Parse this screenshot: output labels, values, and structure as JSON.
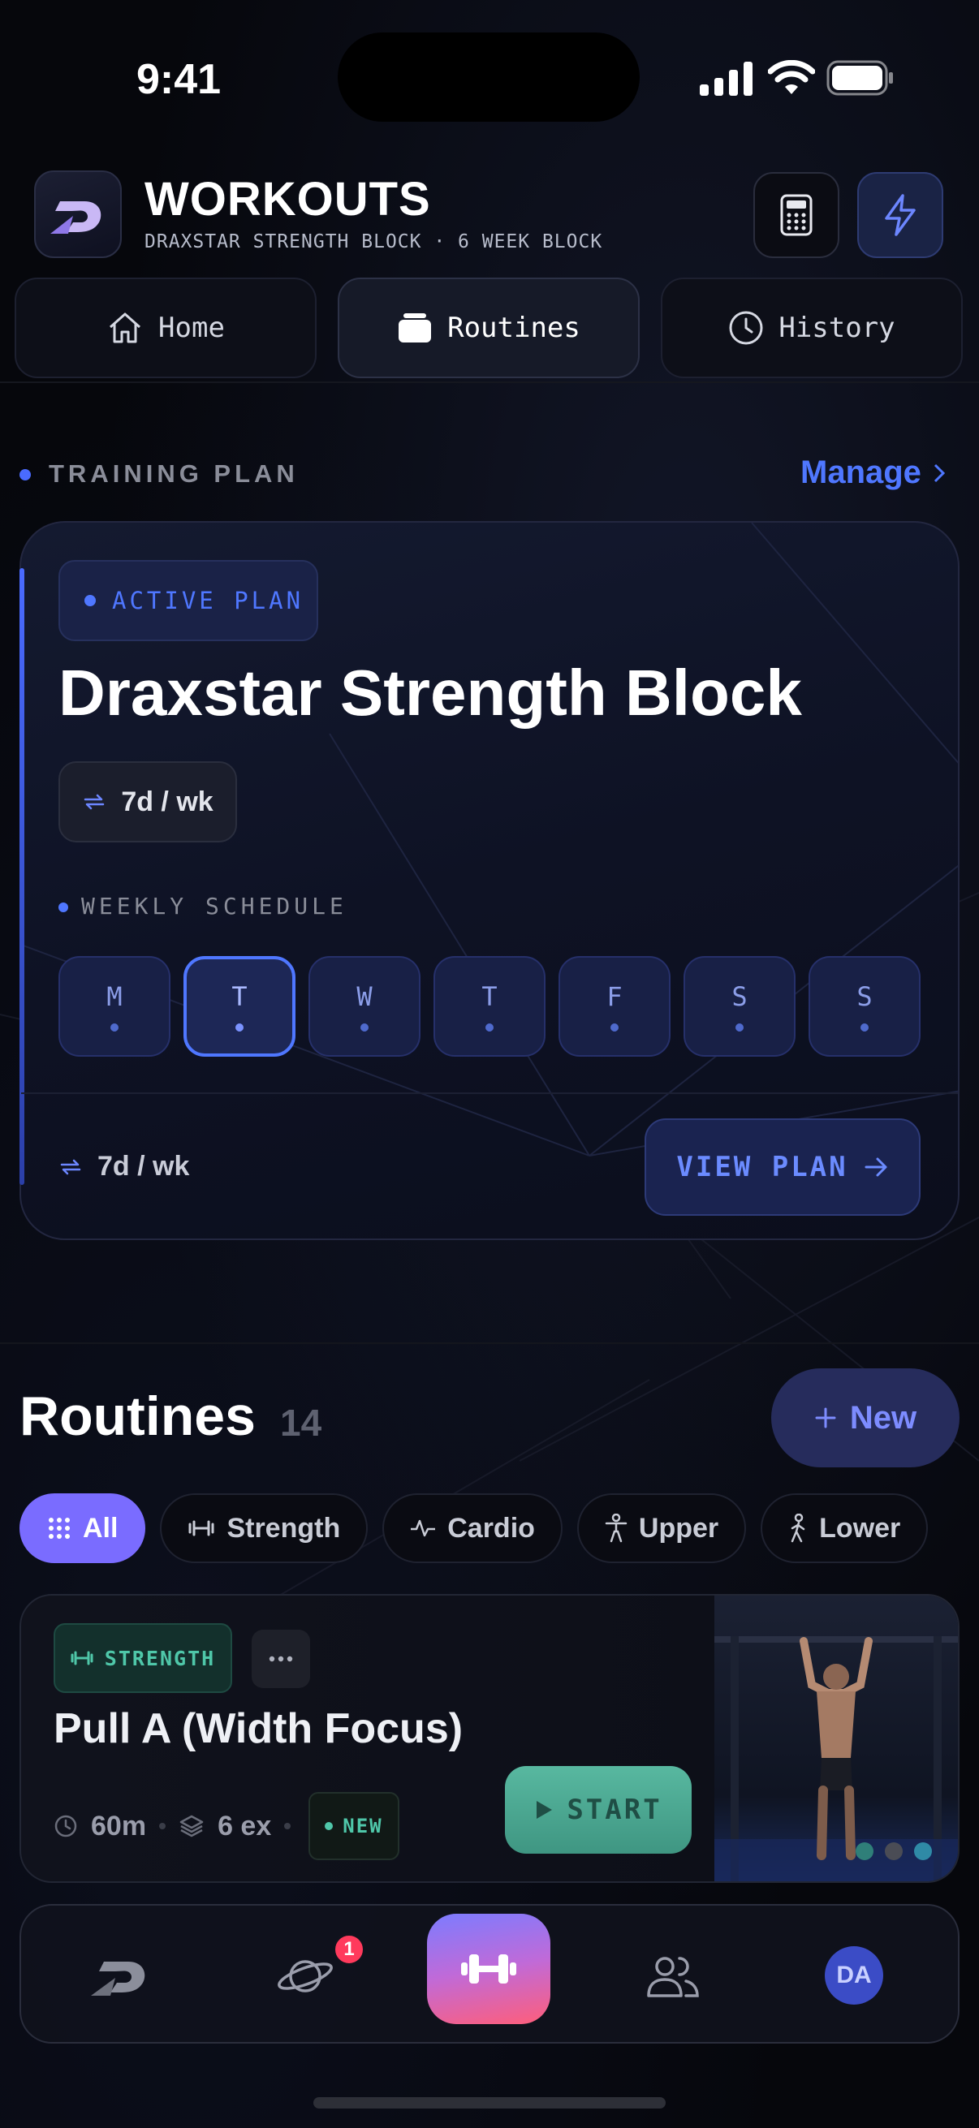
{
  "status_bar": {
    "time": "9:41"
  },
  "header": {
    "title": "WORKOUTS",
    "subtitle": "DRAXSTAR STRENGTH BLOCK · 6 WEEK BLOCK",
    "icons": [
      "app-logo",
      "calculator-icon",
      "bolt-icon"
    ]
  },
  "tabs": [
    {
      "label": "Home",
      "icon": "home-icon"
    },
    {
      "label": "Routines",
      "icon": "folder-icon",
      "active": true
    },
    {
      "label": "History",
      "icon": "clock-icon"
    }
  ],
  "training_plan": {
    "section_label": "TRAINING PLAN",
    "manage_label": "Manage",
    "status_label": "ACTIVE PLAN",
    "name": "Draxstar Strength Block",
    "frequency": "7d / wk",
    "schedule_label": "WEEKLY SCHEDULE",
    "days": [
      "M",
      "T",
      "W",
      "T",
      "F",
      "S",
      "S"
    ],
    "current_day_index": 1,
    "footer_frequency": "7d / wk",
    "view_plan_label": "VIEW PLAN"
  },
  "routines": {
    "title": "Routines",
    "count": "14",
    "new_label": "New",
    "filters": [
      {
        "label": "All",
        "icon": "grid-icon",
        "active": true
      },
      {
        "label": "Strength",
        "icon": "dumbbell-icon"
      },
      {
        "label": "Cardio",
        "icon": "pulse-icon"
      },
      {
        "label": "Upper",
        "icon": "person-icon"
      },
      {
        "label": "Lower",
        "icon": "walk-icon"
      }
    ],
    "items": [
      {
        "category": "STRENGTH",
        "name": "Pull A (Width Focus)",
        "duration": "60m",
        "exercises": "6 ex",
        "badge": "NEW",
        "start_label": "START",
        "image_dot_colors": [
          "#2f7f79",
          "#4a4c55",
          "#2f8aa6"
        ]
      }
    ]
  },
  "bottom_nav": {
    "items": [
      "app-logo",
      "planet-icon",
      "dumbbell-icon",
      "people-icon",
      "avatar"
    ],
    "notification_count": "1",
    "avatar_initials": "DA"
  },
  "colors": {
    "accent": "#4f77ff",
    "chip_active": "#7a6cff",
    "strength": "#4fc7a9",
    "badge": "#ff3a5c"
  }
}
